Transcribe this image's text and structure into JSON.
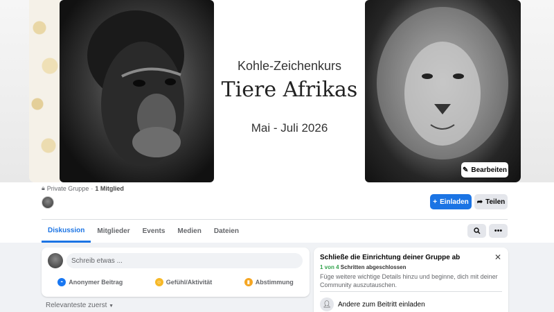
{
  "cover": {
    "subtitle": "Kohle-Zeichenkurs",
    "title": "Tiere Afrikas",
    "date": "Mai - Juli 2026",
    "edit_label": "Bearbeiten"
  },
  "group": {
    "privacy": "Private Gruppe",
    "separator": " · ",
    "members": "1 Mitglied"
  },
  "actions": {
    "invite_label": "Einladen",
    "share_label": "Teilen"
  },
  "tabs": [
    {
      "label": "Diskussion",
      "active": true
    },
    {
      "label": "Mitglieder"
    },
    {
      "label": "Events"
    },
    {
      "label": "Medien"
    },
    {
      "label": "Dateien"
    }
  ],
  "composer": {
    "placeholder": "Schreib etwas ...",
    "actions": [
      {
        "label": "Anonymer Beitrag",
        "icon": "incognito-icon",
        "color": "#1877f2"
      },
      {
        "label": "Gefühl/Aktivität",
        "icon": "smiley-icon",
        "color": "#f7b928"
      },
      {
        "label": "Abstimmung",
        "icon": "poll-icon",
        "color": "#f5a623"
      }
    ]
  },
  "sort": {
    "label": "Relevanteste zuerst"
  },
  "setup": {
    "title": "Schließe die Einrichtung deiner Gruppe ab",
    "progress_count": "1 von 4",
    "progress_rest": " Schritten abgeschlossen",
    "description": "Füge weitere wichtige Details hinzu und beginne, dich mit deiner Community auszutauschen.",
    "item": "Andere zum Beitritt einladen"
  },
  "colors": {
    "accent": "#1b74e4",
    "success": "#31a24c"
  }
}
